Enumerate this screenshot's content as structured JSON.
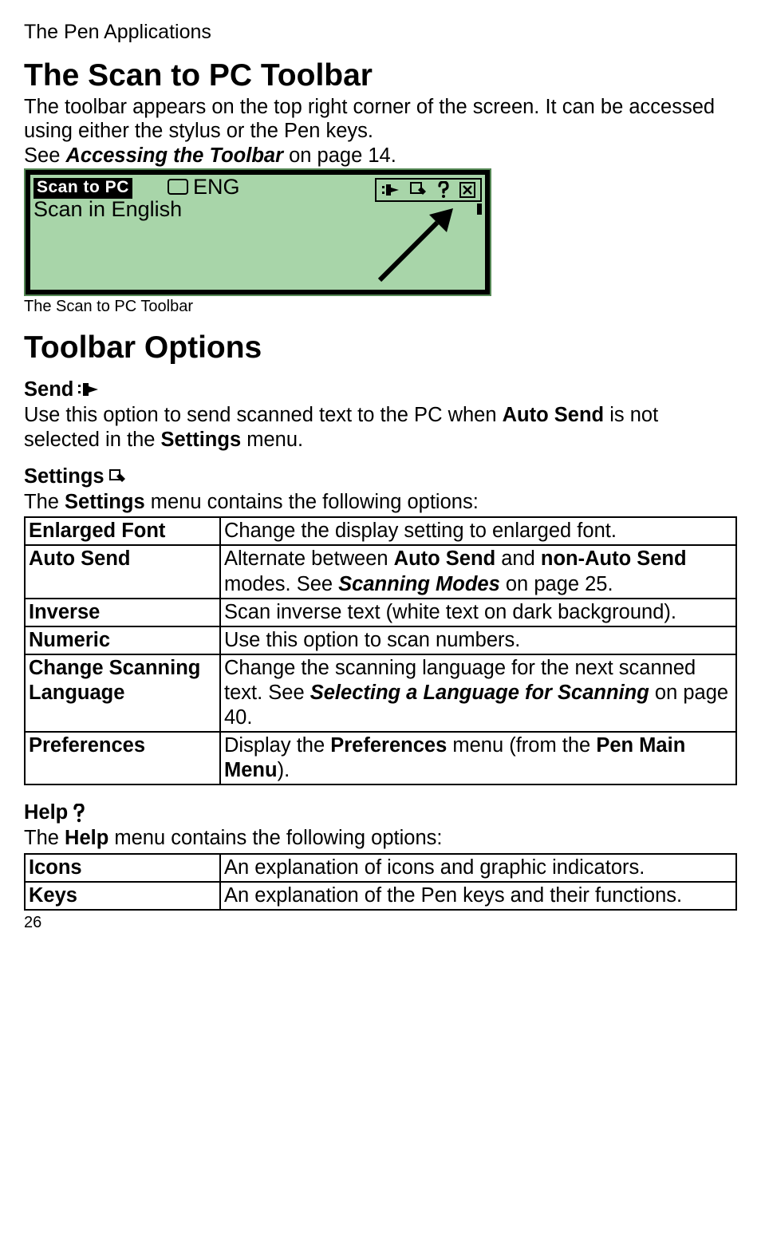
{
  "header": "The Pen Applications",
  "h1_a": "The Scan to PC Toolbar",
  "intro_a": "The toolbar appears on the top right corner of the screen. It can be accessed using either the stylus or the Pen keys.",
  "ref_pre": "See ",
  "ref_bi": "Accessing the Toolbar",
  "ref_post": " on page 14.",
  "device": {
    "app": "Scan to PC",
    "lang": "ENG",
    "sub": "Scan in English"
  },
  "caption": "The Scan to PC Toolbar",
  "h1_b": "Toolbar Options",
  "send": {
    "title": "Send",
    "p_pre": "Use this option to send scanned text to the PC when ",
    "p_b1": "Auto Send",
    "p_mid": " is not selected in the ",
    "p_b2": "Settings",
    "p_post": " menu."
  },
  "settings": {
    "title": "Settings",
    "intro_pre": "The ",
    "intro_b": "Settings",
    "intro_post": " menu contains the following options:",
    "rows": [
      {
        "label": "Enlarged Font",
        "d1": "Change the display setting to enlarged font."
      },
      {
        "label": "Auto Send",
        "d2a": "Alternate between ",
        "d2b1": "Auto Send",
        "d2c": " and ",
        "d2b2": "non-Auto Send",
        "d2d": " modes. See ",
        "d2bi": "Scanning Modes",
        "d2e": " on page 25."
      },
      {
        "label": "Inverse",
        "d3": "Scan inverse text (white text on dark background)."
      },
      {
        "label": "Numeric",
        "d4": "Use this option to scan numbers."
      },
      {
        "label": "Change Scanning Language",
        "d5a": "Change the scanning language for the next scanned text. See ",
        "d5bi": "Selecting a Language for Scanning",
        "d5b": " on page 40."
      },
      {
        "label": "Preferences",
        "d6a": "Display the ",
        "d6b1": "Preferences",
        "d6b": " menu (from the ",
        "d6b2": "Pen Main Menu",
        "d6c": ")."
      }
    ]
  },
  "help": {
    "title": "Help",
    "intro_pre": "The ",
    "intro_b": "Help",
    "intro_post": " menu contains the following options:",
    "rows": [
      {
        "label": "Icons",
        "d": "An explanation of icons and graphic indicators."
      },
      {
        "label": "Keys",
        "d": "An explanation of the Pen keys and their functions."
      }
    ]
  },
  "page_number": "26"
}
